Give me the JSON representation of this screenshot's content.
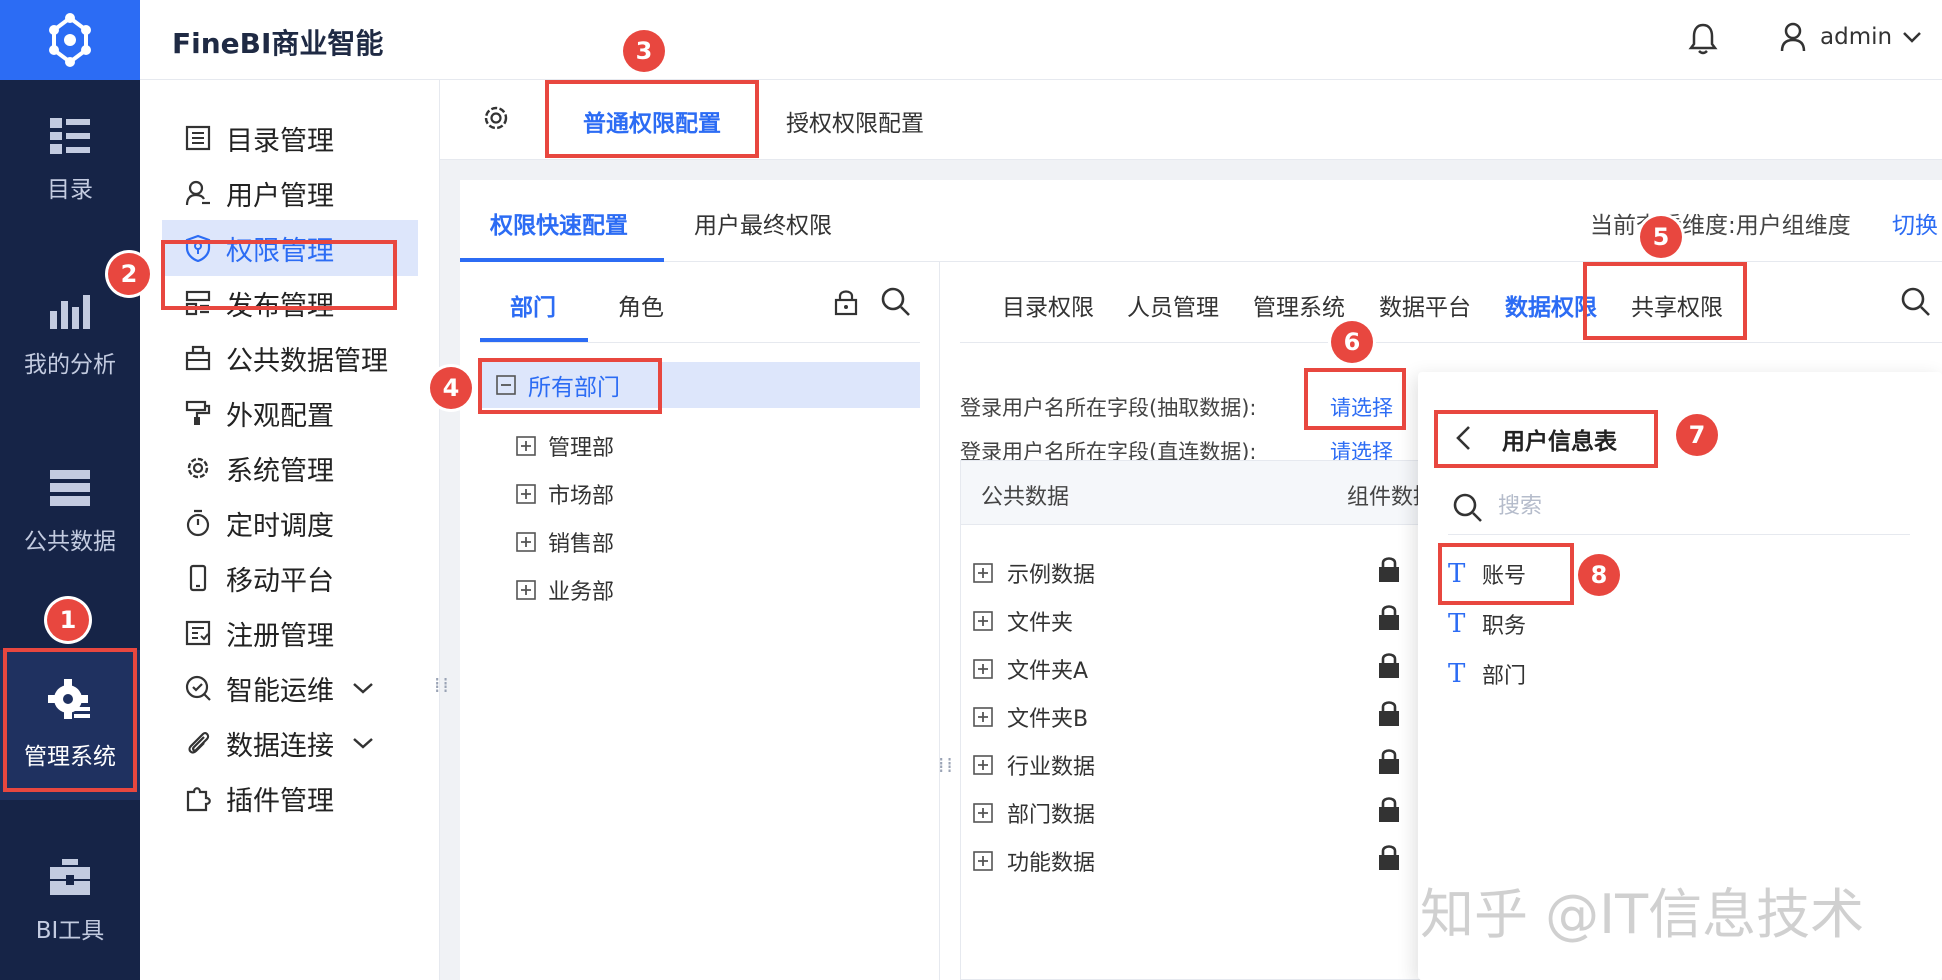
{
  "header": {
    "brand": "FineBI商业智能",
    "user": "admin"
  },
  "rail": {
    "items": [
      {
        "label": "目录",
        "icon": "list-icon"
      },
      {
        "label": "我的分析",
        "icon": "chart-icon"
      },
      {
        "label": "公共数据",
        "icon": "database-icon"
      },
      {
        "label": "管理系统",
        "icon": "gear-icon"
      },
      {
        "label": "BI工具",
        "icon": "toolbox-icon"
      }
    ]
  },
  "menu": {
    "items": [
      {
        "label": "目录管理"
      },
      {
        "label": "用户管理"
      },
      {
        "label": "权限管理"
      },
      {
        "label": "发布管理"
      },
      {
        "label": "公共数据管理"
      },
      {
        "label": "外观配置"
      },
      {
        "label": "系统管理"
      },
      {
        "label": "定时调度"
      },
      {
        "label": "移动平台"
      },
      {
        "label": "注册管理"
      },
      {
        "label": "智能运维"
      },
      {
        "label": "数据连接"
      },
      {
        "label": "插件管理"
      }
    ]
  },
  "topTabs": [
    "普通权限配置",
    "授权权限配置"
  ],
  "subTabs": [
    "权限快速配置",
    "用户最终权限"
  ],
  "dimension": {
    "label": "当前查看维度:用户组维度",
    "switch": "切换"
  },
  "leftTabs": [
    "部门",
    "角色"
  ],
  "tree": {
    "root": "所有部门",
    "children": [
      "管理部",
      "市场部",
      "销售部",
      "业务部"
    ]
  },
  "permTabs": [
    "目录权限",
    "人员管理",
    "管理系统",
    "数据平台",
    "数据权限",
    "共享权限"
  ],
  "fields": {
    "extract_label": "登录用户名所在字段(抽取数据):",
    "direct_label": "登录用户名所在字段(直连数据):",
    "select": "请选择"
  },
  "table": {
    "col1": "公共数据",
    "col2": "组件数据",
    "rows": [
      "示例数据",
      "文件夹",
      "文件夹A",
      "文件夹B",
      "行业数据",
      "部门数据",
      "功能数据"
    ]
  },
  "popup": {
    "title": "用户信息表",
    "search_placeholder": "搜索",
    "fields": [
      "账号",
      "职务",
      "部门"
    ]
  },
  "watermark": "知乎 @IT信息技术",
  "badges": [
    "1",
    "2",
    "3",
    "4",
    "5",
    "6",
    "7",
    "8"
  ],
  "colors": {
    "accent": "#2c6cf4",
    "rail": "#162447",
    "highlight": "#e8473f"
  }
}
